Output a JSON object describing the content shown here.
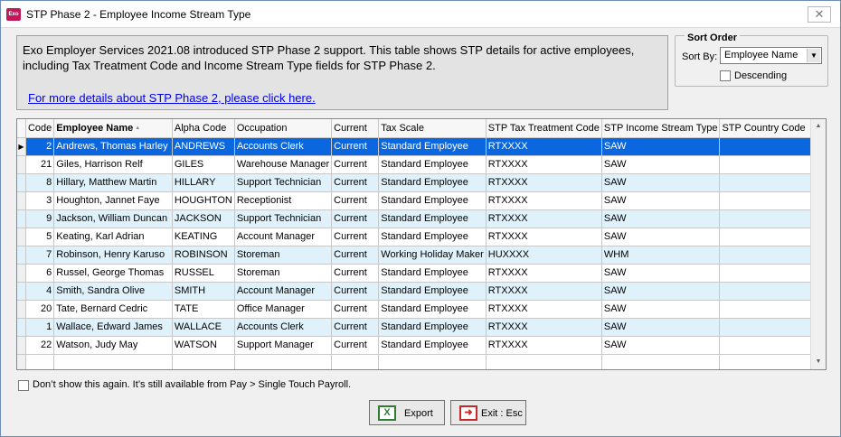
{
  "window": {
    "title": "STP Phase 2 - Employee Income Stream Type",
    "app_icon_text": "Exo",
    "close_glyph": "✕"
  },
  "info": {
    "text": "Exo Employer Services 2021.08 introduced STP Phase 2 support. This table shows STP details for active employees, including Tax Treatment Code and Income Stream Type fields for STP Phase 2.",
    "link": "For more details about STP Phase 2, please click here."
  },
  "sort": {
    "legend": "Sort Order",
    "sortby_label": "Sort By:",
    "sortby_value": "Employee Name",
    "descending_label": "Descending",
    "descending_checked": false
  },
  "grid": {
    "columns": [
      "Code",
      "Employee Name",
      "Alpha Code",
      "Occupation",
      "Current",
      "Tax Scale",
      "STP Tax Treatment Code",
      "STP Income Stream Type",
      "STP Country Code"
    ],
    "sort_indicator": "▲",
    "selected_row": 0,
    "rows": [
      [
        "2",
        "Andrews, Thomas Harley",
        "ANDREWS",
        "Accounts Clerk",
        "Current",
        "Standard Employee",
        "RTXXXX",
        "SAW",
        ""
      ],
      [
        "21",
        "Giles, Harrison Relf",
        "GILES",
        "Warehouse Manager",
        "Current",
        "Standard Employee",
        "RTXXXX",
        "SAW",
        ""
      ],
      [
        "8",
        "Hillary, Matthew Martin",
        "HILLARY",
        "Support Technician",
        "Current",
        "Standard Employee",
        "RTXXXX",
        "SAW",
        ""
      ],
      [
        "3",
        "Houghton, Jannet Faye",
        "HOUGHTON",
        "Receptionist",
        "Current",
        "Standard Employee",
        "RTXXXX",
        "SAW",
        ""
      ],
      [
        "9",
        "Jackson, William Duncan",
        "JACKSON",
        "Support Technician",
        "Current",
        "Standard Employee",
        "RTXXXX",
        "SAW",
        ""
      ],
      [
        "5",
        "Keating, Karl Adrian",
        "KEATING",
        "Account Manager",
        "Current",
        "Standard Employee",
        "RTXXXX",
        "SAW",
        ""
      ],
      [
        "7",
        "Robinson, Henry Karuso",
        "ROBINSON",
        "Storeman",
        "Current",
        "Working Holiday Maker",
        "HUXXXX",
        "WHM",
        ""
      ],
      [
        "6",
        "Russel, George Thomas",
        "RUSSEL",
        "Storeman",
        "Current",
        "Standard Employee",
        "RTXXXX",
        "SAW",
        ""
      ],
      [
        "4",
        "Smith, Sandra Olive",
        "SMITH",
        "Account Manager",
        "Current",
        "Standard Employee",
        "RTXXXX",
        "SAW",
        ""
      ],
      [
        "20",
        "Tate, Bernard Cedric",
        "TATE",
        "Office Manager",
        "Current",
        "Standard Employee",
        "RTXXXX",
        "SAW",
        ""
      ],
      [
        "1",
        "Wallace, Edward James",
        "WALLACE",
        "Accounts Clerk",
        "Current",
        "Standard Employee",
        "RTXXXX",
        "SAW",
        ""
      ],
      [
        "22",
        "Watson, Judy May",
        "WATSON",
        "Support Manager",
        "Current",
        "Standard Employee",
        "RTXXXX",
        "SAW",
        ""
      ]
    ]
  },
  "footer": {
    "dont_show_label": "Don’t show this again. It’s still available from Pay > Single Touch Payroll.",
    "export_label": "Export",
    "exit_label": "Exit : Esc"
  },
  "icons": {
    "export": "excel-export-icon",
    "exit": "exit-door-icon"
  }
}
